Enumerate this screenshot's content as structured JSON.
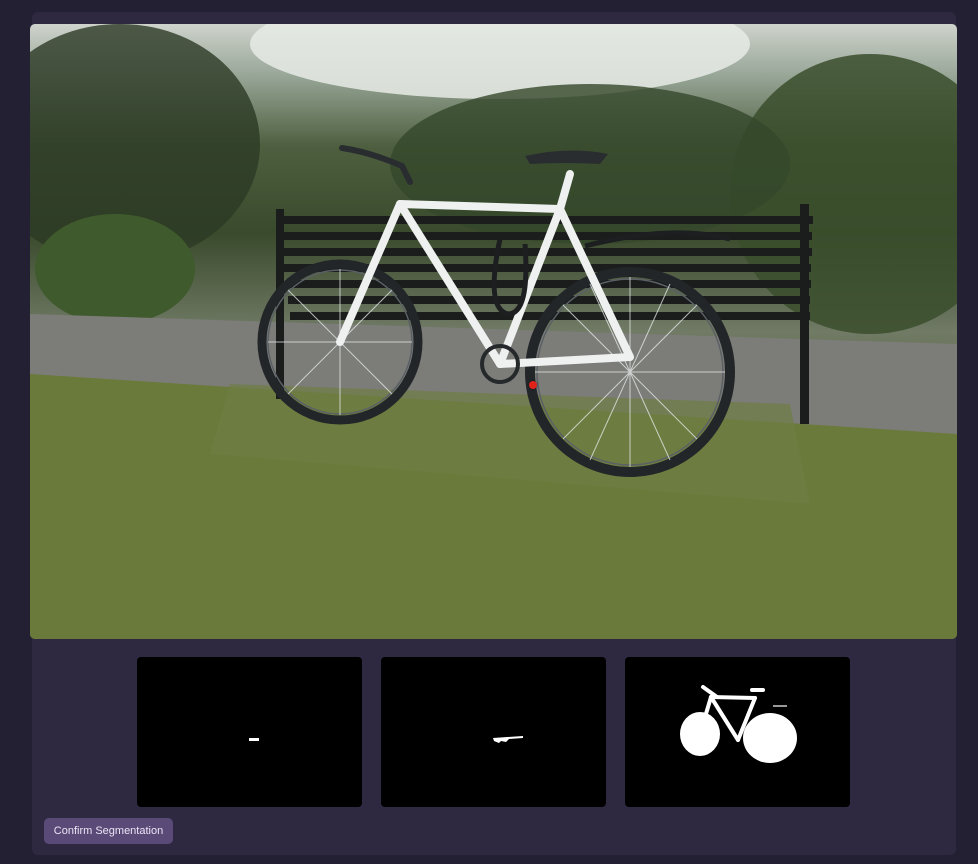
{
  "viewer": {
    "image": "bicycle-leaning-on-park-bench",
    "click_point_color": "#e0221b"
  },
  "mask_candidates": [
    {
      "name": "mask-option-small"
    },
    {
      "name": "mask-option-medium"
    },
    {
      "name": "mask-option-full-bicycle"
    }
  ],
  "actions": {
    "confirm_label": "Confirm Segmentation"
  },
  "colors": {
    "page_bg": "#242033",
    "panel_bg": "#2e2940",
    "button_bg": "#5a4a78",
    "mask_fg": "#ffffff",
    "mask_bg": "#000000"
  }
}
